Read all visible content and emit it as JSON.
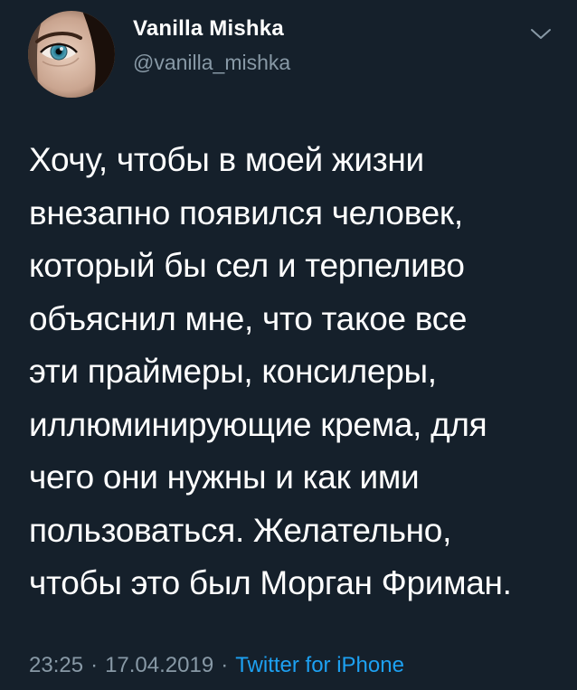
{
  "author": {
    "name": "Vanilla Mishka",
    "handle": "@vanilla_mishka"
  },
  "tweet": {
    "lines": [
      "Хочу, чтобы в моей жизни",
      "внезапно появился человек,",
      "который бы сел и терпеливо",
      "объяснил мне, что такое все",
      "эти праймеры, консилеры,",
      "иллюминирующие крема, для",
      "чего они нужны и как ими",
      "пользоваться. Желательно,",
      "чтобы это был Морган Фриман."
    ]
  },
  "meta": {
    "time": "23:25",
    "date": "17.04.2019",
    "separator": "·",
    "source": "Twitter for iPhone"
  },
  "colors": {
    "background": "#15202b",
    "text": "#ffffff",
    "secondary": "#8899a6",
    "link": "#1da1f2"
  },
  "icons": {
    "menu": "chevron-down-icon"
  }
}
